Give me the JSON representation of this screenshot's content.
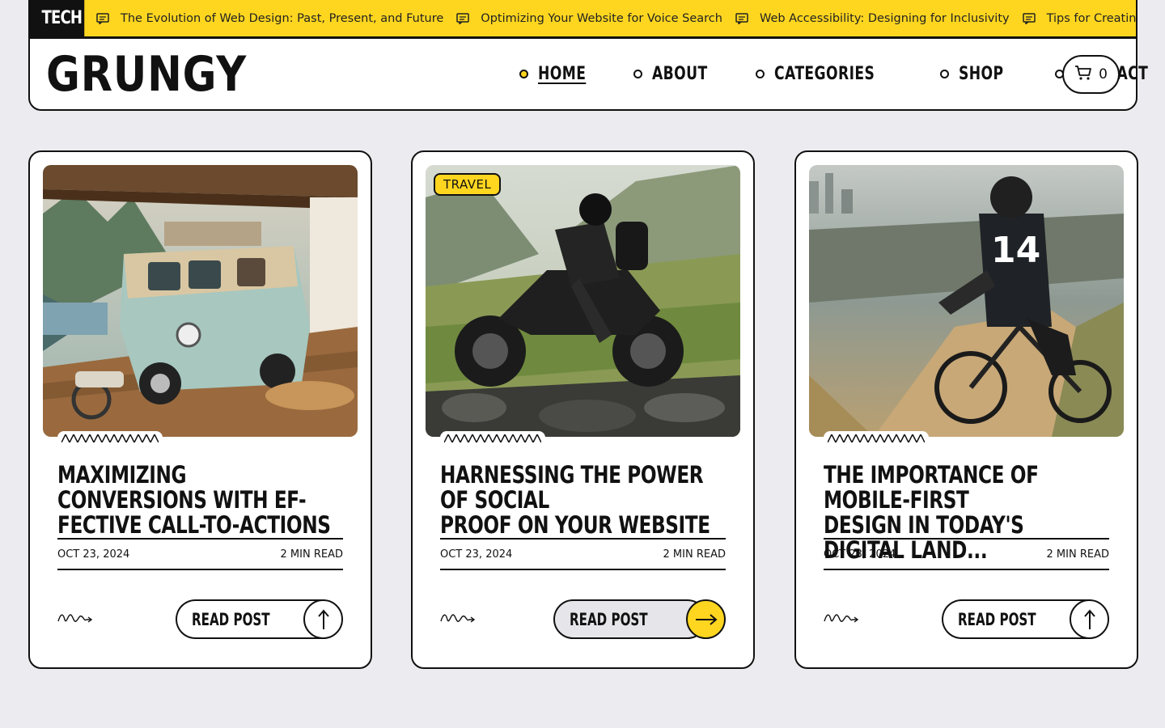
{
  "ticker": {
    "tag": "TECH",
    "items": [
      "The Evolution of Web Design: Past, Present, and Future",
      "Optimizing Your Website for Voice Search",
      "Web Accessibility: Designing for Inclusivity",
      "Tips for Creating SEO-"
    ]
  },
  "header": {
    "logo": "GRUNGY",
    "nav": [
      "HOME",
      "ABOUT",
      "CATEGORIES",
      "SHOP",
      "CONTACT"
    ],
    "active_nav": "HOME",
    "cart_count": "0"
  },
  "colors": {
    "accent": "#ffd61f",
    "ink": "#111111",
    "background": "#ececf0"
  },
  "cards": [
    {
      "title": "MAXIMIZING CONVERSIONS WITH EF-FECTIVE CALL-TO-ACTIONS",
      "title_lines": [
        "MAXIMIZING CONVERSIONS WITH EF-",
        "FECTIVE CALL-TO-ACTIONS"
      ],
      "date": "OCT 23, 2024",
      "read_time": "2 MIN READ",
      "button": "READ POST",
      "badge": "",
      "image": "camper-van-on-terrace"
    },
    {
      "title": "HARNESSING THE POWER OF SOCIAL PROOF ON YOUR WEBSITE",
      "title_lines": [
        "HARNESSING THE POWER OF SOCIAL",
        "PROOF ON YOUR WEBSITE"
      ],
      "date": "OCT 23, 2024",
      "read_time": "2 MIN READ",
      "button": "READ POST",
      "badge": "TRAVEL",
      "image": "motorcycle-rider-in-mountains"
    },
    {
      "title": "THE IMPORTANCE OF MOBILE-FIRST DESIGN IN TODAY'S DIGITAL LAND...",
      "title_lines": [
        "THE IMPORTANCE OF MOBILE-FIRST",
        "DESIGN IN TODAY'S DIGITAL LAND..."
      ],
      "date": "OCT 23, 2024",
      "read_time": "2 MIN READ",
      "button": "READ POST",
      "badge": "",
      "image": "mountain-biker-above-city"
    }
  ]
}
